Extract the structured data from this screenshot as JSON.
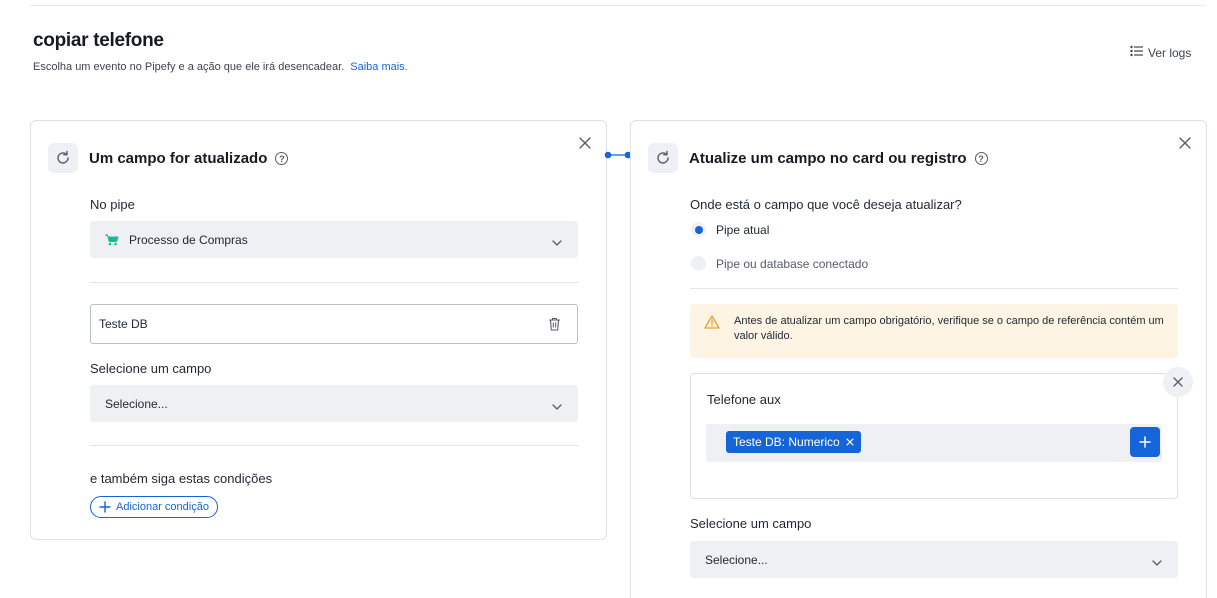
{
  "header": {
    "title": "copiar telefone",
    "subtitle": "Escolha um evento no Pipefy e a ação que ele irá desencadear.",
    "learn_more": "Saiba mais.",
    "logs_label": "Ver logs"
  },
  "trigger": {
    "title": "Um campo for atualizado",
    "pipe_label": "No pipe",
    "pipe_value": "Processo de Compras",
    "db_value": "Teste DB",
    "field_label": "Selecione um campo",
    "field_placeholder": "Selecione...",
    "conditions_label": "e também siga estas condições",
    "add_condition": "Adicionar condição"
  },
  "action": {
    "title": "Atualize um campo no card ou registro",
    "question": "Onde está o campo que você deseja atualizar?",
    "options": [
      {
        "label": "Pipe atual",
        "selected": true
      },
      {
        "label": "Pipe ou database conectado",
        "selected": false
      }
    ],
    "warning": "Antes de atualizar um campo obrigatório, verifique se o campo de referência contém um valor válido.",
    "target_field": "Telefone aux",
    "tag": "Teste DB: Numerico",
    "field_label": "Selecione um campo",
    "field_placeholder": "Selecione..."
  },
  "colors": {
    "accent": "#1565d8",
    "cart": "#17b897",
    "warning_bg": "#fdf4e3",
    "warning_icon": "#e2a22c"
  }
}
